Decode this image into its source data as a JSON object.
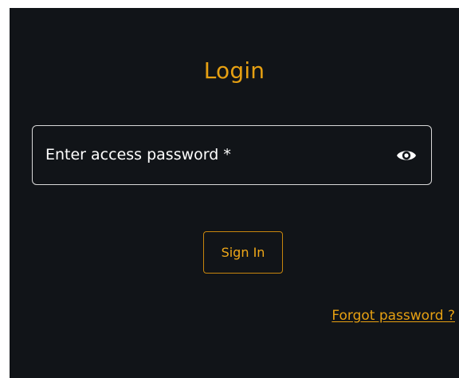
{
  "login": {
    "title": "Login",
    "password_field": {
      "placeholder": "Enter access password *",
      "icon": "eye-icon"
    },
    "sign_in_label": "Sign In",
    "forgot_password_label": "Forgot password ?"
  },
  "colors": {
    "background": "#111418",
    "accent": "#e6a012",
    "field_border": "#d8d8d8",
    "text": "#ffffff"
  }
}
